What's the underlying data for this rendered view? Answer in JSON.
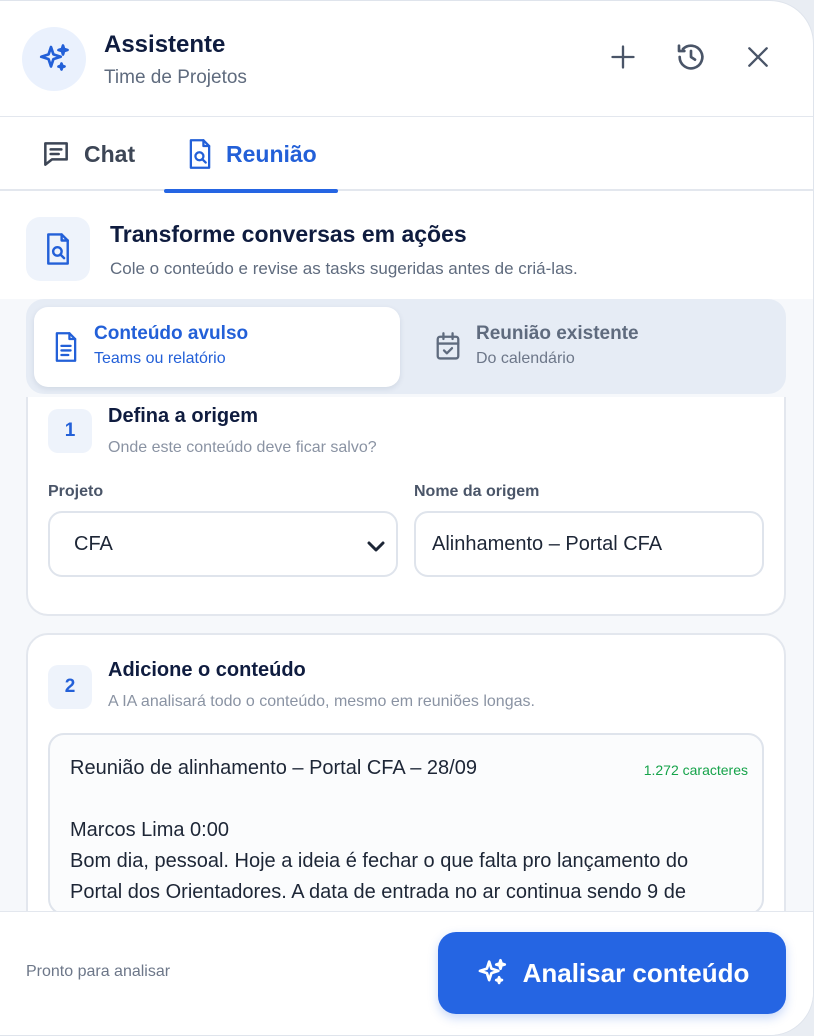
{
  "header": {
    "title": "Assistente",
    "subtitle": "Time de Projetos",
    "icons": {
      "avatar": "sparkles-icon",
      "new": "plus-icon",
      "history": "history-icon",
      "close": "close-icon"
    }
  },
  "tabs": [
    {
      "label": "Chat",
      "icon": "message-icon",
      "active": false
    },
    {
      "label": "Reunião",
      "icon": "document-search-icon",
      "active": true
    }
  ],
  "intro": {
    "title": "Transforme conversas em ações",
    "subtitle": "Cole o conteúdo e revise as tasks sugeridas antes de criá-las."
  },
  "modes": [
    {
      "title": "Conteúdo avulso",
      "subtitle": "Teams ou relatório",
      "icon": "document-icon",
      "selected": true
    },
    {
      "title": "Reunião existente",
      "subtitle": "Do calendário",
      "icon": "calendar-check-icon",
      "selected": false
    }
  ],
  "step1": {
    "number": "1",
    "title": "Defina a origem",
    "subtitle": "Onde este conteúdo deve ficar salvo?",
    "project_label": "Projeto",
    "project_value": "CFA",
    "origin_label": "Nome da origem",
    "origin_value": "Alinhamento – Portal CFA"
  },
  "step2": {
    "number": "2",
    "title": "Adicione o conteúdo",
    "subtitle": "A IA analisará todo o conteúdo, mesmo em reuniões longas.",
    "content": "Reunião de alinhamento – Portal CFA – 28/09\n\nMarcos Lima 0:00\nBom dia, pessoal. Hoje a ideia é fechar o que falta pro lançamento do Portal dos Orientadores. A data de entrada no ar continua sendo 9 de",
    "char_count": "1.272 caracteres"
  },
  "footer": {
    "status": "Pronto para analisar",
    "analyze_label": "Analisar conteúdo"
  },
  "colors": {
    "accent": "#2565e3",
    "success": "#16a34a"
  }
}
